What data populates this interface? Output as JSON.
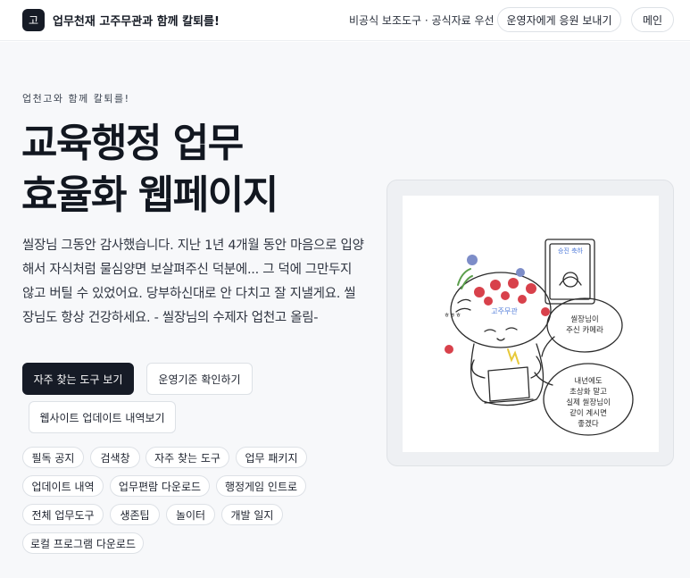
{
  "header": {
    "logo_char": "고",
    "brand": "업무천재 고주무관과 함께 칼퇴를!",
    "notice": "비공식 보조도구 · 공식자료 우선",
    "donate_button": "운영자에게 응원 보내기",
    "main_button": "메인"
  },
  "hero": {
    "eyebrow": "업천고와 함께 칼퇴를!",
    "title_line1": "교육행정 업무",
    "title_line2": "효율화 웹페이지",
    "description": "씰장님 그동안 감사했습니다. 지난 1년 4개월 동안 마음으로 입양해서 자식처럼 물심양면 보살펴주신 덕분에... 그 덕에 그만두지 않고 버틸 수 있었어요. 당부하신대로 안 다치고 잘 지낼게요. 씰장님도 항상 건강하세요. - 씰장님의 수제자 업천고 올림-",
    "btn_tools": "자주 찾는 도구 보기",
    "btn_rules": "운영기준 확인하기",
    "btn_updates": "웹사이트 업데이트 내역보기"
  },
  "chips": [
    "필독 공지",
    "검색창",
    "자주 찾는 도구",
    "업무 패키지",
    "업데이트 내역",
    "업무편람 다운로드",
    "행정게임 인트로",
    "전체 업무도구",
    "생존팁",
    "놀이터",
    "개발 일지",
    "로컬 프로그램 다운로드"
  ],
  "illustration": {
    "frame_text": "승진 축하",
    "name_tag": "고주무관",
    "bubble_top_line1": "씰장님이",
    "bubble_top_line2": "주신 카메라",
    "bubble_bottom_line1": "내년에도",
    "bubble_bottom_line2": "초상화 말고",
    "bubble_bottom_line3": "실제 씰장님이",
    "bubble_bottom_line4": "같이 계시면",
    "bubble_bottom_line5": "좋겠다",
    "side_marks": "ㅎㅎㅎ"
  },
  "colors": {
    "primary": "#161b26",
    "background": "#f7f8fa",
    "border": "#dde1e6",
    "flower_red": "#d8414b",
    "flower_blue": "#7d8dc8",
    "leaf_green": "#5a9e4b",
    "accent_blue": "#4f7bd9",
    "accent_yellow": "#e7c93a"
  }
}
